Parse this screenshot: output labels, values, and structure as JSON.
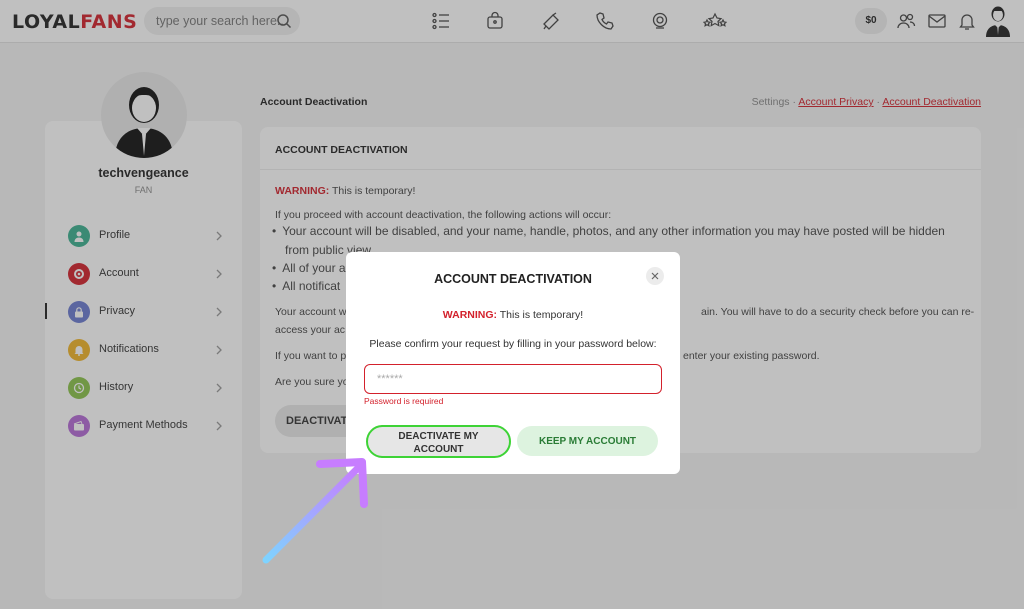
{
  "header": {
    "logo_main": "L",
    "logo_o": "O",
    "logo_rest": "YAL",
    "logo_accent": "FANS",
    "search_placeholder": "type your search here...",
    "balance": "$0"
  },
  "sidebar": {
    "username": "techvengeance",
    "role": "FAN",
    "items": [
      {
        "label": "Profile",
        "color": "#3bb08f"
      },
      {
        "label": "Account",
        "color": "#d3212c"
      },
      {
        "label": "Privacy",
        "color": "#6b7bd0"
      },
      {
        "label": "Notifications",
        "color": "#f0b429"
      },
      {
        "label": "History",
        "color": "#8bc34a"
      },
      {
        "label": "Payment Methods",
        "color": "#b46bd6"
      }
    ]
  },
  "main": {
    "page_title": "Account Deactivation",
    "breadcrumb": {
      "settings": "Settings",
      "sep": " · ",
      "privacy": "Account Privacy",
      "current": "Account Deactivation"
    },
    "card_title": "ACCOUNT DEACTIVATION",
    "warning_label": "WARNING:",
    "warning_text": " This is temporary!",
    "intro": "If you proceed with account deactivation, the following actions will occur:",
    "bullets": [
      "Your account will be disabled, and your name, handle, photos, and any other information you may have posted will be hidden",
      "from public view.",
      "All of your a",
      "All notificat"
    ],
    "para1a": "Your account w",
    "para1b": "ain. You will have to do a security check before you can re-",
    "para1c": "access your ac",
    "para2a": "If you want to p",
    "para2b": "enter your existing password.",
    "para3": "Are you sure yo",
    "deactivate_button": "DEACTIVATE"
  },
  "modal": {
    "title": "ACCOUNT DEACTIVATION",
    "warning_label": "WARNING:",
    "warning_text": " This is temporary!",
    "instruction": "Please confirm your request by filling in your password below:",
    "password_placeholder": "******",
    "error": "Password is required",
    "deactivate_line1": "DEACTIVATE MY",
    "deactivate_line2": "ACCOUNT",
    "keep_button": "KEEP MY ACCOUNT"
  },
  "icons": {
    "search": "search-icon",
    "close": "close-icon",
    "arrow": "pointer-arrow-icon"
  },
  "colors": {
    "brand_red": "#d3212c",
    "highlight_green": "#3ed336",
    "keep_green": "#2a7c36",
    "arrow_gradient_start": "#7fd3ff",
    "arrow_gradient_end": "#c77dff"
  }
}
